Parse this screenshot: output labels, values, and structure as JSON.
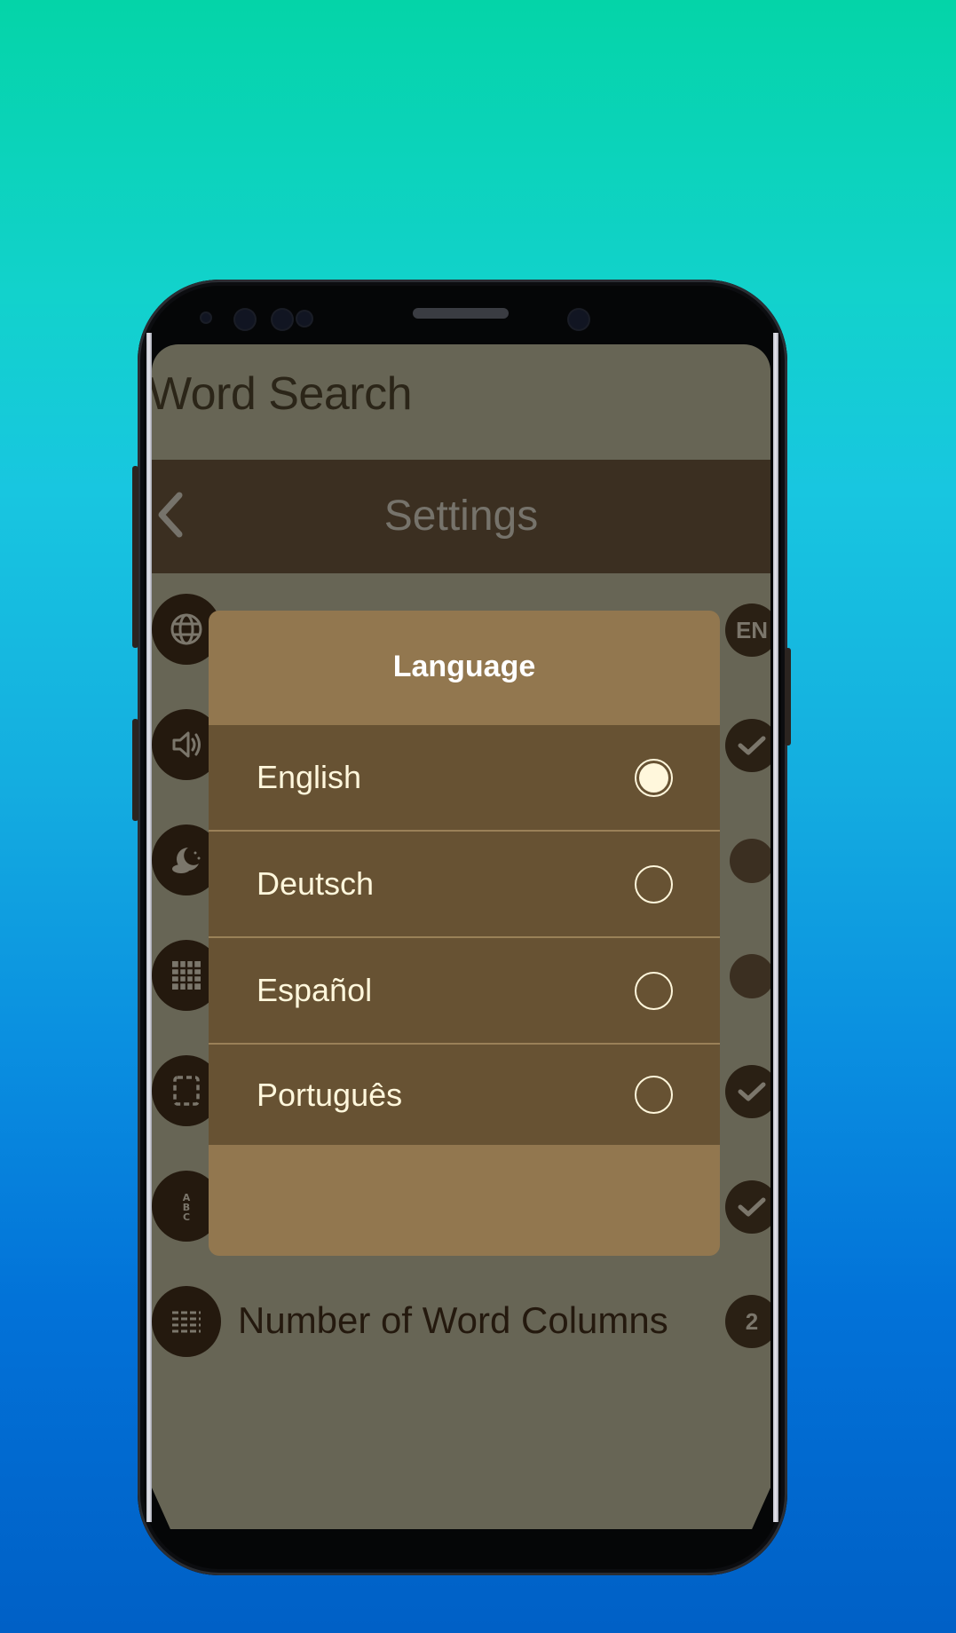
{
  "app": {
    "title": "Word Search"
  },
  "toolbar": {
    "back_icon": "chevron-left-icon",
    "title": "Settings"
  },
  "settings": [
    {
      "icon": "globe-icon",
      "label": "",
      "value": "EN",
      "value_type": "text"
    },
    {
      "icon": "speaker-icon",
      "label": "",
      "value": "checked",
      "value_type": "check"
    },
    {
      "icon": "night-moon-icon",
      "label": "",
      "value": "unchecked",
      "value_type": "empty"
    },
    {
      "icon": "grid-icon",
      "label": "",
      "value": "unchecked",
      "value_type": "empty"
    },
    {
      "icon": "dashed-square-icon",
      "label": "",
      "value": "checked",
      "value_type": "check"
    },
    {
      "icon": "abc-icon",
      "label": "",
      "value": "checked",
      "value_type": "check"
    },
    {
      "icon": "columns-list-icon",
      "label": "Number of Word Columns",
      "value": "2",
      "value_type": "text"
    }
  ],
  "dialog": {
    "title": "Language",
    "options": [
      {
        "label": "English",
        "selected": true
      },
      {
        "label": "Deutsch",
        "selected": false
      },
      {
        "label": "Español",
        "selected": false
      },
      {
        "label": "Português",
        "selected": false
      }
    ]
  },
  "colors": {
    "toolbar_bg": "#3b2f21",
    "screen_dimmed_bg": "#676555",
    "dialog_bg": "#92774f",
    "option_bg": "#675233",
    "option_text": "#fff7dc",
    "icon_circle": "#24190e"
  }
}
